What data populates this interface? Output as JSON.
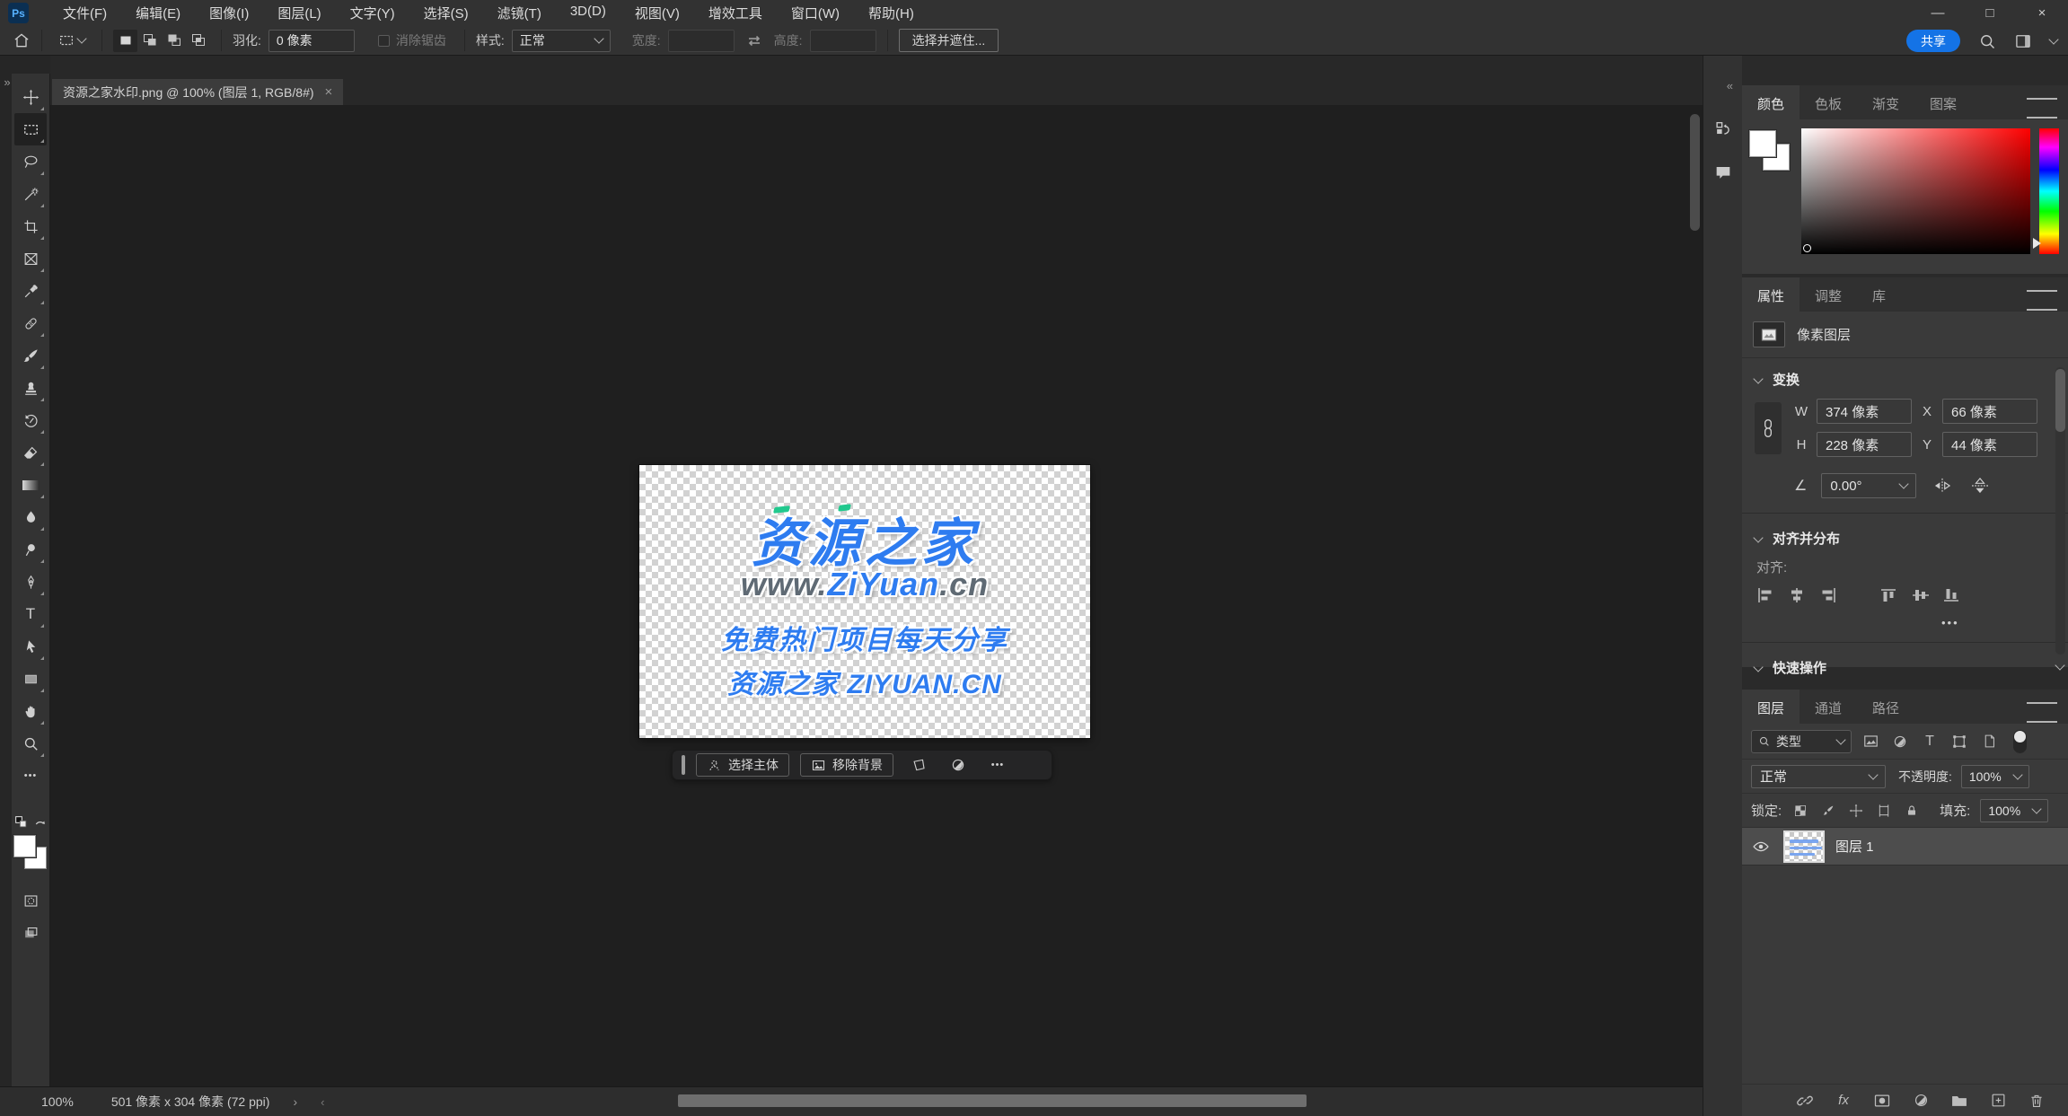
{
  "app": {
    "logo": "Ps"
  },
  "menu_bar": {
    "items": [
      "文件(F)",
      "编辑(E)",
      "图像(I)",
      "图层(L)",
      "文字(Y)",
      "选择(S)",
      "滤镜(T)",
      "3D(D)",
      "视图(V)",
      "增效工具",
      "窗口(W)",
      "帮助(H)"
    ]
  },
  "window_controls": {
    "minimize": "—",
    "maximize": "□",
    "close": "×"
  },
  "options_bar": {
    "feather_label": "羽化:",
    "feather_value": "0 像素",
    "antialias_label": "消除锯齿",
    "style_label": "样式:",
    "style_value": "正常",
    "width_label": "宽度:",
    "width_value": "",
    "height_label": "高度:",
    "height_value": "",
    "select_and_mask": "选择并遮住...",
    "share": "共享"
  },
  "document_tab": {
    "title": "资源之家水印.png @ 100% (图层 1, RGB/8#)",
    "close": "×"
  },
  "canvas": {
    "watermark_title": "资源之家",
    "watermark_url_prefix": "www.",
    "watermark_url_brand": "ZiYuan",
    "watermark_url_suffix": ".cn",
    "watermark_slogan": "免费热门项目每天分享",
    "watermark_footer": "资源之家 ZIYUAN.CN",
    "taskbar": {
      "select_subject": "选择主体",
      "remove_background": "移除背景"
    }
  },
  "color_panel": {
    "tabs": [
      "颜色",
      "色板",
      "渐变",
      "图案"
    ]
  },
  "properties_panel": {
    "tabs": [
      "属性",
      "调整",
      "库"
    ],
    "layer_kind": "像素图层",
    "transform_title": "变换",
    "w_label": "W",
    "w_value": "374 像素",
    "x_label": "X",
    "x_value": "66 像素",
    "h_label": "H",
    "h_value": "228 像素",
    "y_label": "Y",
    "y_value": "44 像素",
    "angle_value": "0.00°",
    "align_title": "对齐并分布",
    "align_label": "对齐:",
    "more": "•••",
    "quick_actions_title": "快速操作"
  },
  "layers_panel": {
    "tabs": [
      "图层",
      "通道",
      "路径"
    ],
    "filter_type": "类型",
    "blend_mode": "正常",
    "opacity_label": "不透明度:",
    "opacity_value": "100%",
    "lock_label": "锁定:",
    "fill_label": "填充:",
    "fill_value": "100%",
    "layer_name": "图层 1",
    "fx_label": "fx"
  },
  "status_bar": {
    "zoom": "100%",
    "doc_info": "501 像素 x 304 像素 (72 ppi)",
    "flyout": "›",
    "scroll_left": "‹"
  },
  "glyphs": {
    "expand": "»",
    "collapse": "«",
    "ellipsis": "•••",
    "type_tool": "T",
    "angle": "∠"
  },
  "colors": {
    "accent_blue": "#1473e6",
    "watermark_blue": "#2e7cf0",
    "watermark_gray": "#5f6a74",
    "watermark_green": "#21c98e",
    "selection_bg": "#4d4d4d"
  },
  "icons": {
    "home": "house",
    "marquee": "dashed-rect",
    "move": "arrow-cross",
    "lasso": "rope-loop",
    "magic-wand": "wand-sparkles",
    "crop": "crop-marks",
    "frame": "rect-x",
    "eyedropper": "dropper",
    "healing-brush": "band-aid",
    "brush": "brush",
    "clone-stamp": "stamp",
    "history-brush": "brush-arc",
    "eraser": "block",
    "gradient": "gradient-rect",
    "blur": "droplet",
    "dodge": "lollipop",
    "pen": "nib",
    "type": "T",
    "path-select": "cursor-arrow",
    "shape": "rectangle",
    "hand": "mitten",
    "zoom": "magnifier",
    "more": "ellipsis",
    "search": "magnifier",
    "workspace": "split-rect",
    "history-panel": "squares-arrow",
    "comments-panel": "speech-bubble",
    "eye": "eye",
    "link": "chain",
    "fx": "fx",
    "layer-mask": "rect-circle",
    "adjustment": "half-circle",
    "group": "folder",
    "new-layer": "plus-square",
    "delete": "trash"
  }
}
